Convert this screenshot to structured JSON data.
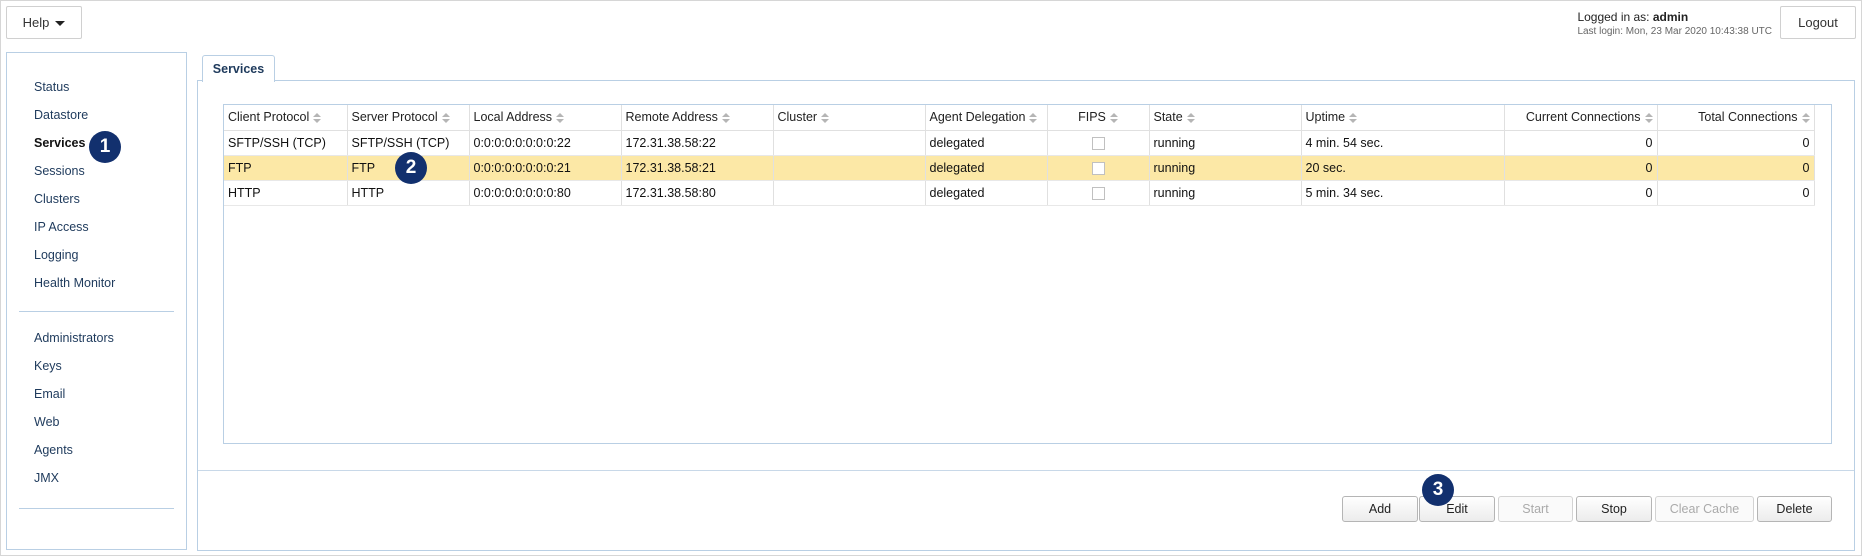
{
  "header": {
    "help_label": "Help",
    "logged_in_prefix": "Logged in as:",
    "user": "admin",
    "last_login": "Last login: Mon, 23 Mar 2020 10:43:38 UTC",
    "logout_label": "Logout"
  },
  "sidebar": {
    "group1": [
      "Status",
      "Datastore",
      "Services",
      "Sessions",
      "Clusters",
      "IP Access",
      "Logging",
      "Health Monitor"
    ],
    "group2": [
      "Administrators",
      "Keys",
      "Email",
      "Web",
      "Agents",
      "JMX"
    ],
    "active": "Services"
  },
  "tab": {
    "label": "Services"
  },
  "table": {
    "columns": [
      "Client Protocol",
      "Server Protocol",
      "Local Address",
      "Remote Address",
      "Cluster",
      "Agent Delegation",
      "FIPS",
      "State",
      "Uptime",
      "Current Connections",
      "Total Connections"
    ],
    "rows": [
      [
        "SFTP/SSH (TCP)",
        "SFTP/SSH (TCP)",
        "0:0:0:0:0:0:0:0:22",
        "172.31.38.58:22",
        "",
        "delegated",
        "",
        "running",
        "4 min. 54 sec.",
        "0",
        "0"
      ],
      [
        "FTP",
        "FTP",
        "0:0:0:0:0:0:0:0:21",
        "172.31.38.58:21",
        "",
        "delegated",
        "",
        "running",
        "20 sec.",
        "0",
        "0"
      ],
      [
        "HTTP",
        "HTTP",
        "0:0:0:0:0:0:0:0:80",
        "172.31.38.58:80",
        "",
        "delegated",
        "",
        "running",
        "5 min. 34 sec.",
        "0",
        "0"
      ]
    ],
    "selected_row": 1
  },
  "buttons": {
    "add": "Add",
    "edit": "Edit",
    "start": "Start",
    "stop": "Stop",
    "clear_cache": "Clear Cache",
    "delete": "Delete"
  },
  "badges": [
    "1",
    "2",
    "3"
  ],
  "colors": {
    "selected_row": "#fce8a6",
    "badge": "#12306e",
    "panel_border": "#b9cfe4"
  }
}
